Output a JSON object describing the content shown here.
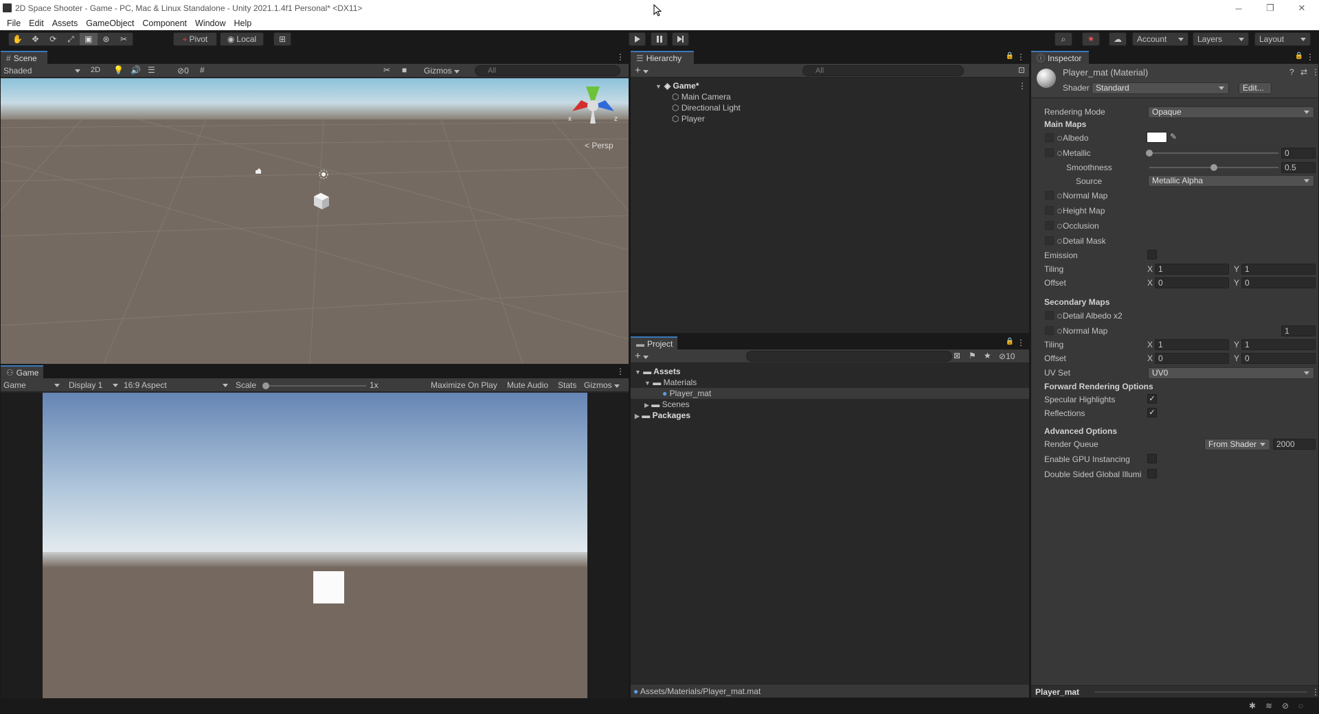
{
  "window": {
    "title": "2D Space Shooter - Game - PC, Mac & Linux Standalone - Unity 2021.1.4f1 Personal* <DX11>"
  },
  "menu": [
    "File",
    "Edit",
    "Assets",
    "GameObject",
    "Component",
    "Window",
    "Help"
  ],
  "toolbar": {
    "pivot": "Pivot",
    "local": "Local",
    "account": "Account",
    "layers": "Layers",
    "layout": "Layout"
  },
  "scene": {
    "tab": "Scene",
    "shading": "Shaded",
    "mode2d": "2D",
    "hidden_count": "0",
    "gizmos": "Gizmos",
    "search_placeholder": "All",
    "persp": "Persp",
    "axis_x": "x",
    "axis_z": "z"
  },
  "game": {
    "tab": "Game",
    "view": "Game",
    "display": "Display 1",
    "aspect": "16:9 Aspect",
    "scale_label": "Scale",
    "scale_value": "1x",
    "maximize": "Maximize On Play",
    "mute": "Mute Audio",
    "stats": "Stats",
    "gizmos": "Gizmos",
    "scale_fraction": 0.0
  },
  "hierarchy": {
    "tab": "Hierarchy",
    "search_placeholder": "All",
    "root": "Game*",
    "children": [
      "Main Camera",
      "Directional Light",
      "Player"
    ]
  },
  "project": {
    "tab": "Project",
    "hidden_count": "10",
    "tree": {
      "assets": "Assets",
      "materials": "Materials",
      "player_mat": "Player_mat",
      "scenes": "Scenes",
      "packages": "Packages"
    },
    "path": "Assets/Materials/Player_mat.mat"
  },
  "inspector": {
    "tab": "Inspector",
    "title": "Player_mat (Material)",
    "shader_label": "Shader",
    "shader_value": "Standard",
    "edit": "Edit...",
    "rendering_mode_label": "Rendering Mode",
    "rendering_mode_value": "Opaque",
    "main_maps": "Main Maps",
    "albedo": "Albedo",
    "metallic": "Metallic",
    "metallic_value": "0",
    "metallic_fraction": 0.0,
    "smoothness": "Smoothness",
    "smoothness_value": "0.5",
    "smoothness_fraction": 0.5,
    "source": "Source",
    "source_value": "Metallic Alpha",
    "normal_map": "Normal Map",
    "height_map": "Height Map",
    "occlusion": "Occlusion",
    "detail_mask": "Detail Mask",
    "emission": "Emission",
    "tiling": "Tiling",
    "offset": "Offset",
    "x": "X",
    "y": "Y",
    "tiling_x": "1",
    "tiling_y": "1",
    "offset_x": "0",
    "offset_y": "0",
    "secondary_maps": "Secondary Maps",
    "detail_albedo": "Detail Albedo x2",
    "normal_map2": "Normal Map",
    "normal_map2_value": "1",
    "tiling2_x": "1",
    "tiling2_y": "1",
    "offset2_x": "0",
    "offset2_y": "0",
    "uv_set": "UV Set",
    "uv_set_value": "UV0",
    "forward_options": "Forward Rendering Options",
    "specular": "Specular Highlights",
    "reflections": "Reflections",
    "advanced": "Advanced Options",
    "render_queue": "Render Queue",
    "render_queue_source": "From Shader",
    "render_queue_value": "2000",
    "gpu_instancing": "Enable GPU Instancing",
    "double_sided": "Double Sided Global Illumi",
    "check_mark": "✓",
    "preview_name": "Player_mat"
  },
  "colors": {
    "accent": "#3a79bb",
    "panel": "#282828",
    "bar": "#3c3c3c"
  }
}
